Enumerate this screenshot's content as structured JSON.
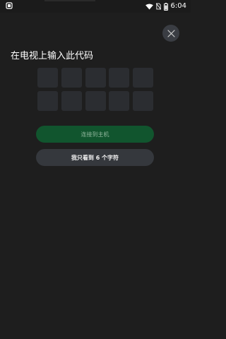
{
  "status_bar": {
    "time": "6:04",
    "icons": [
      "notification-icon",
      "wifi-icon",
      "no-sim-icon",
      "battery-icon"
    ]
  },
  "close_button": {
    "icon": "close-icon"
  },
  "title": "在电视上输入此代码",
  "code_cells": [
    "",
    "",
    "",
    "",
    "",
    "",
    "",
    "",
    "",
    ""
  ],
  "connect_button": {
    "label": "连接到主机"
  },
  "six_chars_button": {
    "label": "我只看到 6 个字符"
  },
  "colors": {
    "background": "#1e1e1e",
    "connect_button": "#11552e",
    "secondary_button": "#35383d",
    "code_cell": "#2b2d31"
  }
}
